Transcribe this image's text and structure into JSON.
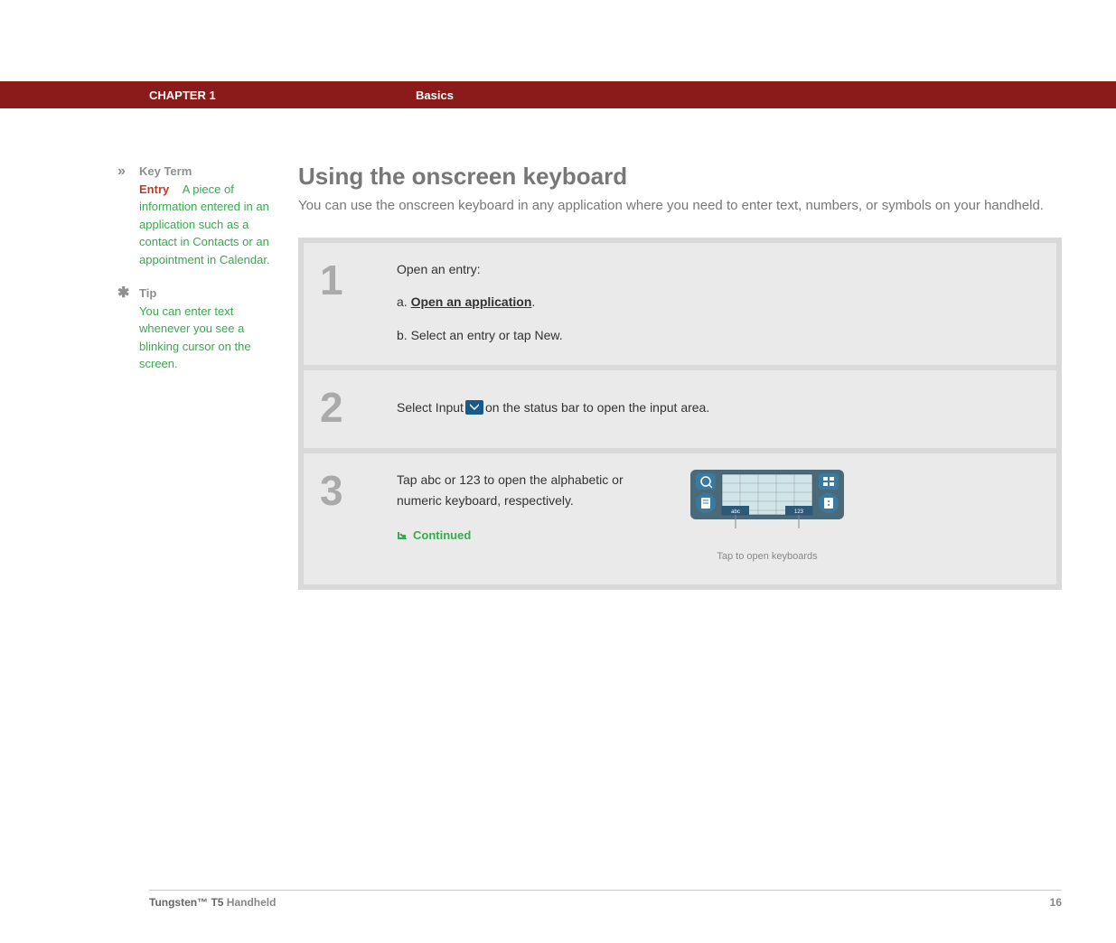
{
  "header": {
    "chapter": "CHAPTER 1",
    "section": "Basics"
  },
  "sidebar": {
    "keyterm": {
      "label": "Key Term",
      "term": "Entry",
      "body": "A piece of information entered in an application such as a contact in Contacts or an appointment in Calendar."
    },
    "tip": {
      "label": "Tip",
      "body": "You can enter text whenever you see a blinking cursor on the screen."
    }
  },
  "main": {
    "title": "Using the onscreen keyboard",
    "intro": "You can use the onscreen keyboard in any application where you need to enter text, numbers, or symbols on your handheld.",
    "steps": {
      "s1": {
        "num": "1",
        "lead": "Open an entry:",
        "a_prefix": "a.  ",
        "a_link": "Open an application",
        "a_suffix": ".",
        "b": "b.  Select an entry or tap New."
      },
      "s2": {
        "num": "2",
        "pre": "Select Input ",
        "post": " on the status bar to open the input area."
      },
      "s3": {
        "num": "3",
        "text": "Tap abc or 123 to open the alphabetic or numeric keyboard, respectively.",
        "continued": "Continued",
        "caption": "Tap to open keyboards",
        "abc": "abc",
        "n123": "123"
      }
    }
  },
  "footer": {
    "product_bold": "Tungsten™ T5",
    "product_rest": " Handheld",
    "page": "16"
  }
}
